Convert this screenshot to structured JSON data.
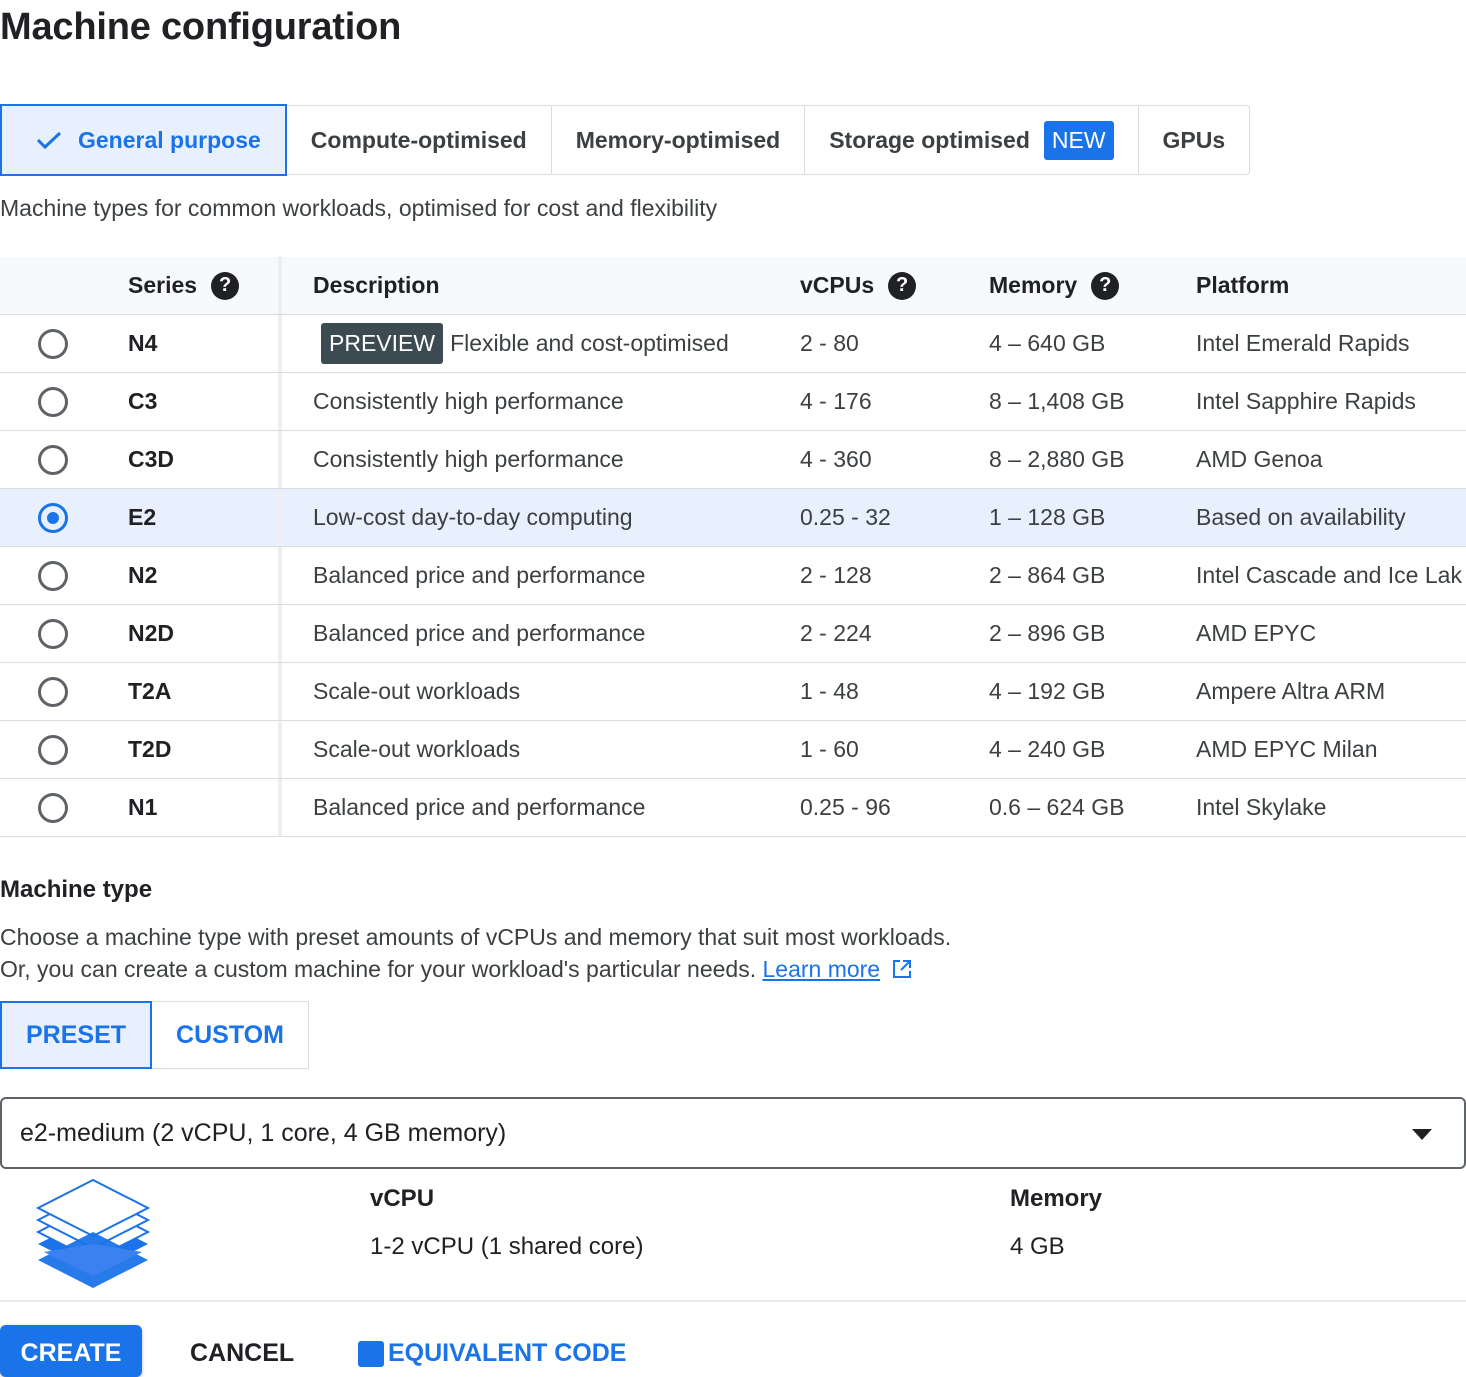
{
  "page_title": "Machine configuration",
  "family_tabs": [
    {
      "label": "General purpose",
      "selected": true
    },
    {
      "label": "Compute-optimised",
      "selected": false
    },
    {
      "label": "Memory-optimised",
      "selected": false
    },
    {
      "label": "Storage optimised",
      "badge": "NEW",
      "selected": false
    },
    {
      "label": "GPUs",
      "selected": false
    }
  ],
  "family_description": "Machine types for common workloads, optimised for cost and flexibility",
  "table": {
    "headers": {
      "series": "Series",
      "description": "Description",
      "vcpus": "vCPUs",
      "memory": "Memory",
      "platform": "Platform"
    },
    "help_glyph": "?",
    "rows": [
      {
        "series": "N4",
        "badge": "PREVIEW",
        "description": "Flexible and cost-optimised",
        "vcpus": "2 - 80",
        "memory": "4 – 640 GB",
        "platform": "Intel Emerald Rapids",
        "selected": false
      },
      {
        "series": "C3",
        "description": "Consistently high performance",
        "vcpus": "4 - 176",
        "memory": "8 – 1,408 GB",
        "platform": "Intel Sapphire Rapids",
        "selected": false
      },
      {
        "series": "C3D",
        "description": "Consistently high performance",
        "vcpus": "4 - 360",
        "memory": "8 – 2,880 GB",
        "platform": "AMD Genoa",
        "selected": false
      },
      {
        "series": "E2",
        "description": "Low-cost day-to-day computing",
        "vcpus": "0.25 - 32",
        "memory": "1 – 128 GB",
        "platform": "Based on availability",
        "selected": true
      },
      {
        "series": "N2",
        "description": "Balanced price and performance",
        "vcpus": "2 - 128",
        "memory": "2 – 864 GB",
        "platform": "Intel Cascade and Ice Lak",
        "selected": false
      },
      {
        "series": "N2D",
        "description": "Balanced price and performance",
        "vcpus": "2 - 224",
        "memory": "2 – 896 GB",
        "platform": "AMD EPYC",
        "selected": false
      },
      {
        "series": "T2A",
        "description": "Scale-out workloads",
        "vcpus": "1 - 48",
        "memory": "4 – 192 GB",
        "platform": "Ampere Altra ARM",
        "selected": false
      },
      {
        "series": "T2D",
        "description": "Scale-out workloads",
        "vcpus": "1 - 60",
        "memory": "4 – 240 GB",
        "platform": "AMD EPYC Milan",
        "selected": false
      },
      {
        "series": "N1",
        "description": "Balanced price and performance",
        "vcpus": "0.25 - 96",
        "memory": "0.6 – 624 GB",
        "platform": "Intel Skylake",
        "selected": false
      }
    ]
  },
  "machine_type": {
    "title": "Machine type",
    "desc_line1": "Choose a machine type with preset amounts of vCPUs and memory that suit most workloads.",
    "desc_line2": "Or, you can create a custom machine for your workload's particular needs.",
    "learn_more": "Learn more",
    "preset_label": "PRESET",
    "custom_label": "CUSTOM",
    "selected_mode": "PRESET",
    "selected_value": "e2-medium (2 vCPU, 1 core, 4 GB memory)",
    "vcpu_label": "vCPU",
    "vcpu_value": "1-2 vCPU (1 shared core)",
    "memory_label": "Memory",
    "memory_value": "4 GB"
  },
  "actions": {
    "create": "CREATE",
    "cancel": "CANCEL",
    "equivalent_code": "EQUIVALENT CODE"
  },
  "icons": {
    "check": "check-icon",
    "help": "help-icon",
    "external_link": "open-in-new-icon",
    "dropdown": "arrow-drop-down-icon",
    "machine": "stacked-layers-icon",
    "code": "code-icon"
  },
  "colors": {
    "accent": "#1a73e8",
    "selected_bg": "#e8f0fe",
    "preview_badge": "#3c4a52"
  }
}
